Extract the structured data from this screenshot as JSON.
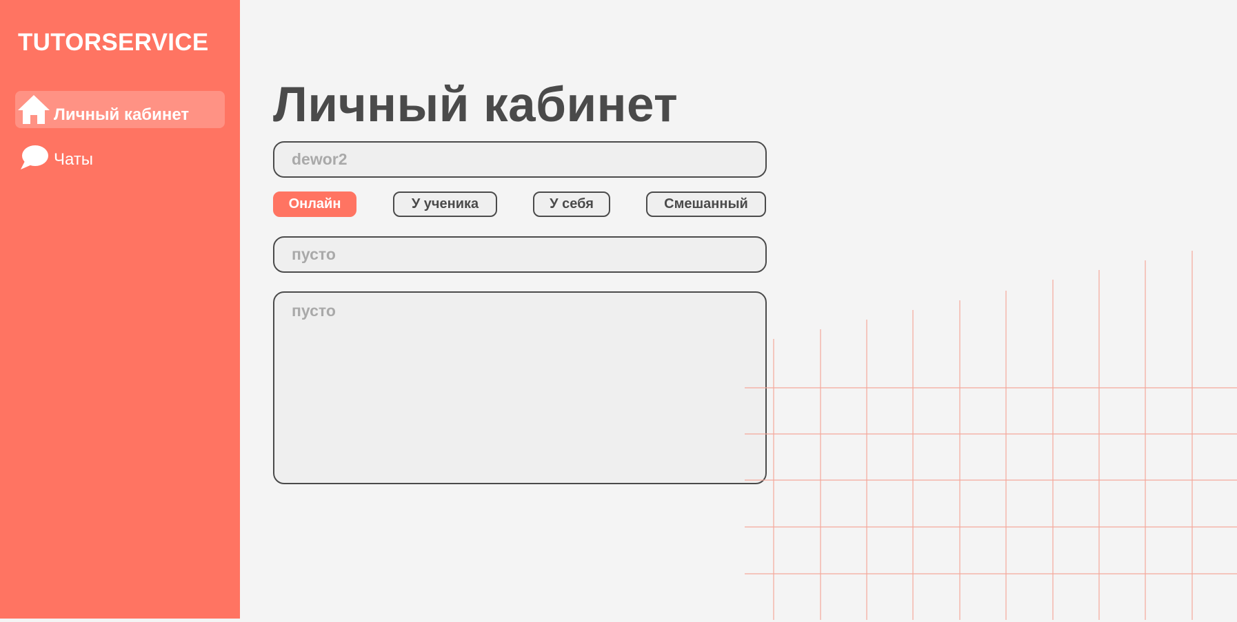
{
  "app": {
    "logo": "TUTORSERVICE",
    "accent_color": "#ff7462"
  },
  "sidebar": {
    "items": [
      {
        "label": "Личный кабинет",
        "icon": "home-icon",
        "active": true
      },
      {
        "label": "Чаты",
        "icon": "chat-bubble-icon",
        "active": false
      }
    ]
  },
  "main": {
    "title": "Личный кабинет",
    "name_field": {
      "value": "",
      "placeholder": "dewor2"
    },
    "format_options": [
      {
        "label": "Онлайн",
        "selected": true
      },
      {
        "label": "У ученика",
        "selected": false
      },
      {
        "label": "У себя",
        "selected": false
      },
      {
        "label": "Смешанный",
        "selected": false
      }
    ],
    "subject_field": {
      "value": "",
      "placeholder": "пусто"
    },
    "about_field": {
      "value": "",
      "placeholder": "пусто"
    }
  }
}
